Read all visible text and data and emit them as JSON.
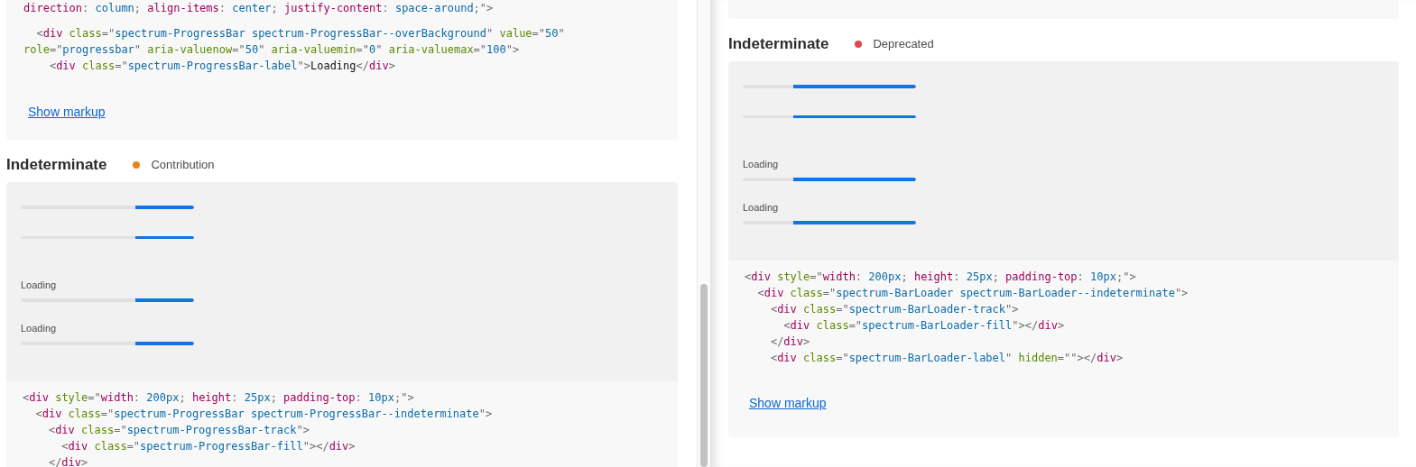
{
  "left_pane": {
    "code_card": {
      "code": [
        "direction: column; align-items: center; justify-content: space-around;\">",
        "  <div class=\"spectrum-ProgressBar spectrum-ProgressBar--overBackground\" value=\"50\"",
        "role=\"progressbar\" aria-valuenow=\"50\" aria-valuemin=\"0\" aria-valuemax=\"100\">",
        "    <div class=\"spectrum-ProgressBar-label\">Loading</div>"
      ],
      "link": "Show markup"
    },
    "section": {
      "title": "Indeterminate",
      "status": {
        "label": "Contribution",
        "color": "#e68619"
      },
      "bars": [
        {
          "kind": "large",
          "level": 0.34
        },
        {
          "kind": "small",
          "level": 0.34
        },
        {
          "kind": "large",
          "label": "Loading",
          "level": 0.34
        },
        {
          "kind": "large",
          "label": "Loading",
          "level": 0.34
        }
      ],
      "code": [
        "<div style=\"width: 200px; height: 25px; padding-top: 10px;\">",
        "  <div class=\"spectrum-ProgressBar spectrum-ProgressBar--indeterminate\">",
        "    <div class=\"spectrum-ProgressBar-track\">",
        "      <div class=\"spectrum-ProgressBar-fill\"></div>",
        "    </div>"
      ]
    }
  },
  "right_pane": {
    "section": {
      "title": "Indeterminate",
      "status": {
        "label": "Deprecated",
        "color": "#e34850"
      },
      "bars": [
        {
          "kind": "large",
          "level": 0.71
        },
        {
          "kind": "small",
          "level": 0.71
        },
        {
          "kind": "large",
          "label": "Loading",
          "level": 0.71
        },
        {
          "kind": "large",
          "label": "Loading",
          "level": 0.71
        }
      ],
      "code": [
        "<div style=\"width: 200px; height: 25px; padding-top: 10px;\">",
        "  <div class=\"spectrum-BarLoader spectrum-BarLoader--indeterminate\">",
        "    <div class=\"spectrum-BarLoader-track\">",
        "      <div class=\"spectrum-BarLoader-fill\"></div>",
        "    </div>",
        "    <div class=\"spectrum-BarLoader-label\" hidden=\"\"></div>"
      ],
      "link": "Show markup"
    }
  }
}
